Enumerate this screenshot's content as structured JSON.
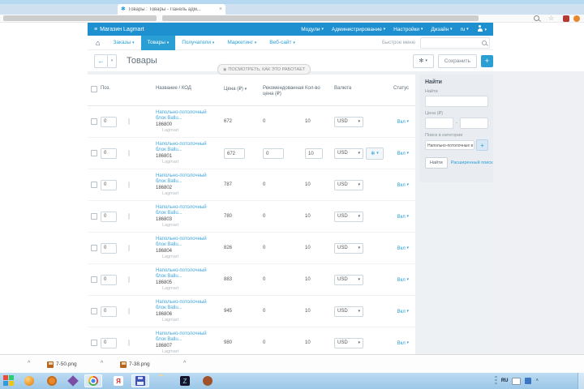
{
  "browser": {
    "tab_title": "Товары : Товары - Панель адм...",
    "tab_close": "×"
  },
  "admin": {
    "brand": "Магазин Lagmart",
    "top_menu": [
      {
        "label": "Модули"
      },
      {
        "label": "Администрирование"
      },
      {
        "label": "Настройки"
      },
      {
        "label": "Дизайн"
      },
      {
        "label": "ru"
      }
    ],
    "nav": [
      {
        "label": "Заказы"
      },
      {
        "label": "Товары"
      },
      {
        "label": "Получатели"
      },
      {
        "label": "Маркетинг"
      },
      {
        "label": "Веб-сайт"
      }
    ],
    "quick_menu_label": "Быстрое меню",
    "page_title": "Товары",
    "tooltip_label": "ПОСМОТРЕТЬ, КАК ЭТО РАБОТАЕТ",
    "save_label": "Сохранить",
    "colors": {
      "accent": "#2a9fd4",
      "header_blue": "#1f90cf"
    },
    "table": {
      "headers": {
        "pos": "Поз.",
        "name": "Название / КОД",
        "price": "Цена (₽)",
        "rec": "Рекомендованная цена (₽)",
        "qty": "Кол-во",
        "currency": "Валюта",
        "status": "Статус"
      },
      "rows": [
        {
          "pos": "0",
          "name_line1": "Напольно-потолочный",
          "name_line2": "блок Ballu...",
          "code": "186800",
          "brand": "Lagmart",
          "price": "672",
          "rec": "0",
          "qty": "10",
          "currency": "USD",
          "status": "Вкл",
          "editable": false
        },
        {
          "pos": "0",
          "name_line1": "Напольно-потолочный",
          "name_line2": "блок Ballu...",
          "code": "186801",
          "brand": "Lagmart",
          "price": "672",
          "rec": "0",
          "qty": "10",
          "currency": "USD",
          "status": "Вкл",
          "editable": true
        },
        {
          "pos": "0",
          "name_line1": "Напольно-потолочный",
          "name_line2": "блок Ballu...",
          "code": "186802",
          "brand": "Lagmart",
          "price": "787",
          "rec": "0",
          "qty": "10",
          "currency": "USD",
          "status": "Вкл",
          "editable": false
        },
        {
          "pos": "0",
          "name_line1": "Напольно-потолочный",
          "name_line2": "блок Ballu...",
          "code": "186803",
          "brand": "Lagmart",
          "price": "780",
          "rec": "0",
          "qty": "10",
          "currency": "USD",
          "status": "Вкл",
          "editable": false
        },
        {
          "pos": "0",
          "name_line1": "Напольно-потолочный",
          "name_line2": "блок Ballu...",
          "code": "186804",
          "brand": "Lagmart",
          "price": "826",
          "rec": "0",
          "qty": "10",
          "currency": "USD",
          "status": "Вкл",
          "editable": false
        },
        {
          "pos": "0",
          "name_line1": "Напольно-потолочный",
          "name_line2": "блок Ballu...",
          "code": "186805",
          "brand": "Lagmart",
          "price": "883",
          "rec": "0",
          "qty": "10",
          "currency": "USD",
          "status": "Вкл",
          "editable": false
        },
        {
          "pos": "0",
          "name_line1": "Напольно-потолочный",
          "name_line2": "блок Ballu...",
          "code": "186806",
          "brand": "Lagmart",
          "price": "945",
          "rec": "0",
          "qty": "10",
          "currency": "USD",
          "status": "Вкл",
          "editable": false
        },
        {
          "pos": "0",
          "name_line1": "Напольно-потолочный",
          "name_line2": "блок Ballu...",
          "code": "186807",
          "brand": "Lagmart",
          "price": "980",
          "rec": "0",
          "qty": "10",
          "currency": "USD",
          "status": "Вкл",
          "editable": false
        }
      ]
    },
    "sidebar": {
      "title": "Найти",
      "find_label": "Найти",
      "price_label": "Цена (₽)",
      "category_label": "Поиск в категории",
      "category_value": "Напольно-потолочные в",
      "find_button": "Найти",
      "advanced_link": "Расширенный поиск"
    }
  },
  "downloads": {
    "items": [
      {
        "name": "7-50.png"
      },
      {
        "name": "7-38.png"
      }
    ]
  },
  "taskbar": {
    "tray_lang": "RU"
  }
}
